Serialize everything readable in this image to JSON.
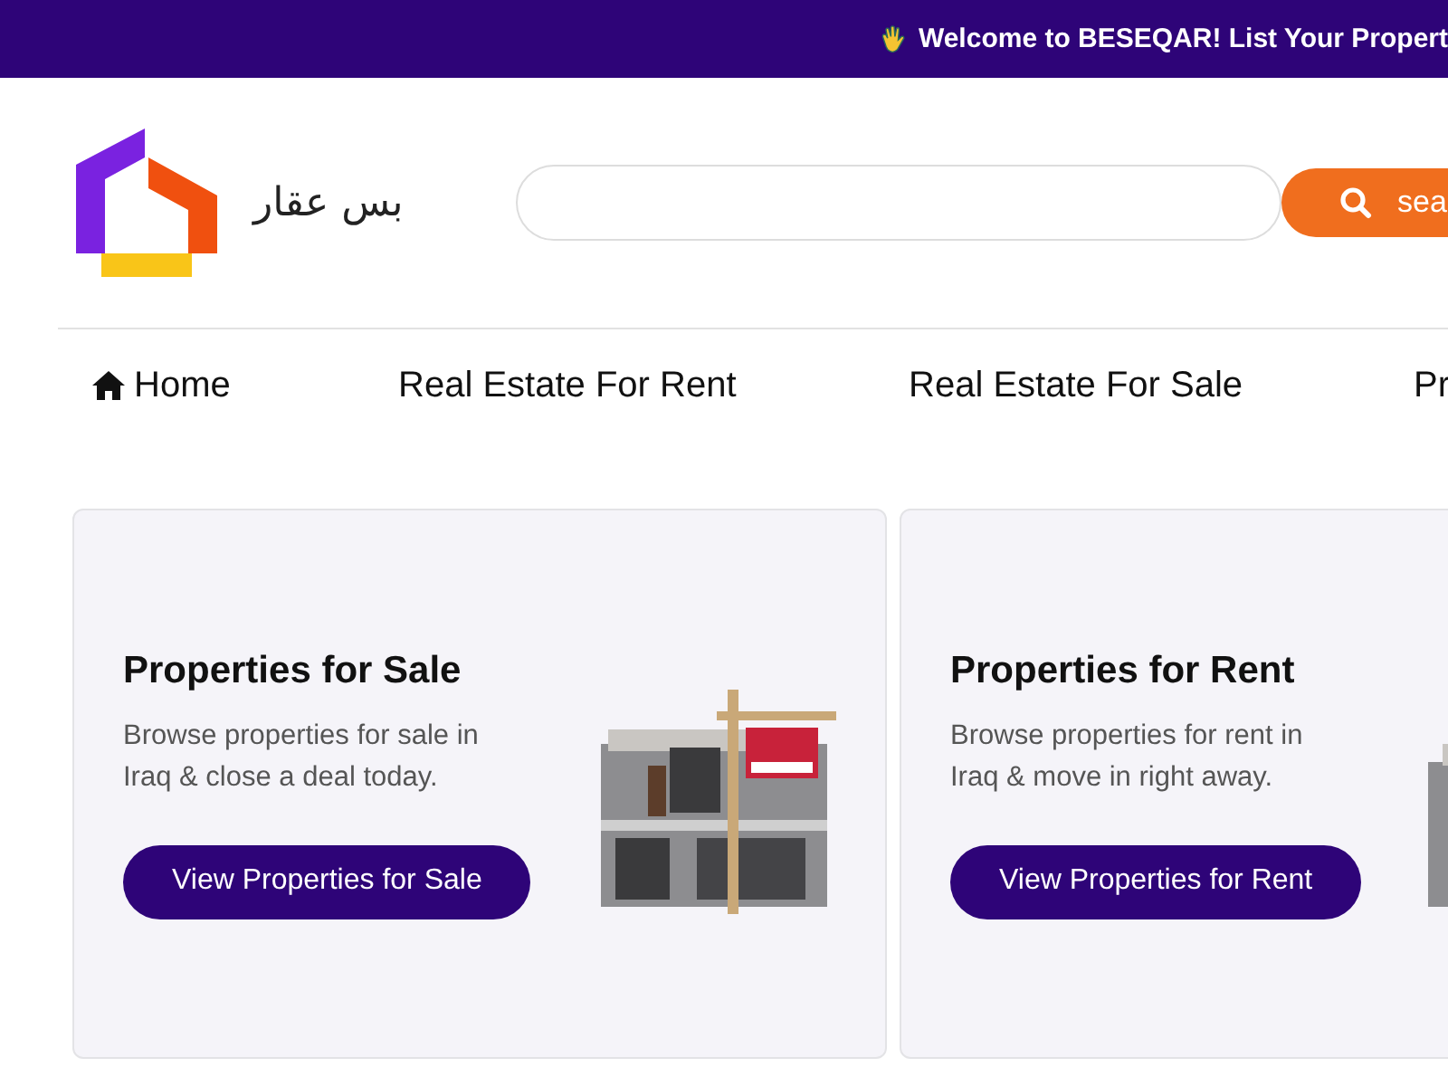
{
  "banner": {
    "text": "Welcome to BESEQAR! List Your Propert"
  },
  "header": {
    "logo_text": "بس عقار",
    "search": {
      "button_label": "sea"
    }
  },
  "nav": [
    {
      "label": "Home",
      "kind": "home"
    },
    {
      "label": "Real Estate For Rent",
      "kind": "link"
    },
    {
      "label": "Real Estate For Sale",
      "kind": "link"
    },
    {
      "label": "Pr",
      "kind": "link"
    }
  ],
  "cards": [
    {
      "kind": "sale",
      "title": "Properties for Sale",
      "description": "Browse properties for sale in Iraq & close a deal today.",
      "button": "View Properties for Sale"
    },
    {
      "kind": "rent",
      "title": "Properties for Rent",
      "description": "Browse properties for rent in Iraq & move in right away.",
      "button": "View Properties for Rent"
    }
  ]
}
